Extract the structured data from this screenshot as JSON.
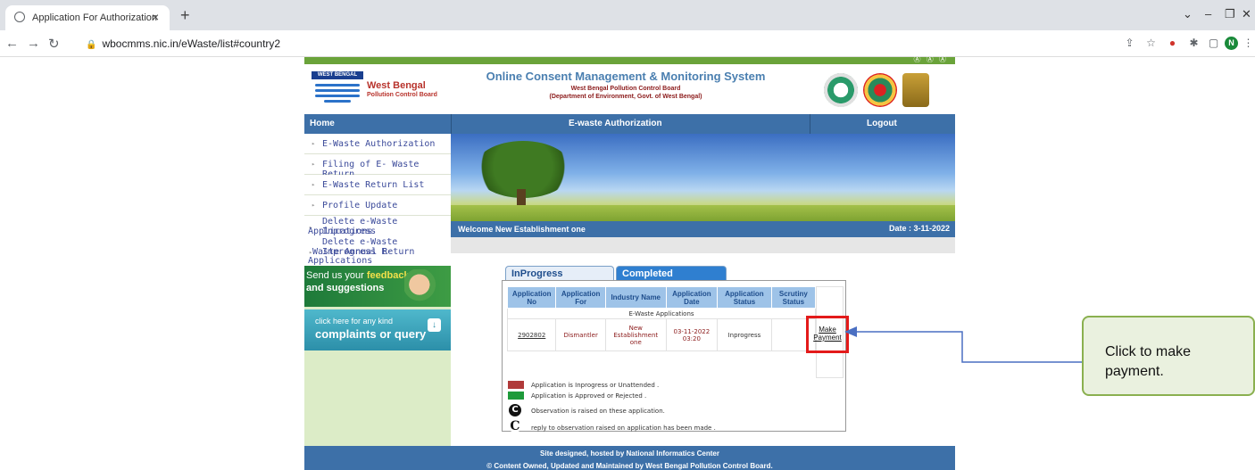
{
  "browser": {
    "tab_title": "Application For Authorization",
    "tab_close": "×",
    "new_tab": "+",
    "url": "wbocmms.nic.in/eWaste/list#country2",
    "profile_initial": "N"
  },
  "header": {
    "access_icons": "Ⓐ Ⓐ Ⓐ",
    "logo_banner": "WEST BENGAL",
    "logo_name": "West Bengal",
    "logo_sub": "Pollution Control Board",
    "title": "Online Consent Management & Monitoring System",
    "sub1": "West Bengal Pollution Control Board",
    "sub2": "(Department of Environment, Govt. of West Bengal)"
  },
  "menu": {
    "home": "Home",
    "ewaste": "E-waste Authorization",
    "logout": "Logout"
  },
  "sidebar": {
    "items": [
      {
        "label": "E-Waste Authorization"
      },
      {
        "label": "Filing of E- Waste Return"
      },
      {
        "label": "E-Waste Return List"
      },
      {
        "label": "Profile Update"
      }
    ],
    "delete_inprogress_l1": "Delete e-Waste Inprogress",
    "delete_inprogress_l2": "Applications",
    "delete_return_l1": "Delete e-Waste Inprogress E-",
    "delete_return_l2": "Waste Annual Return",
    "delete_return_l3": "Applications",
    "feedback_pre": "Send us your ",
    "feedback_bold": "feedback",
    "feedback_line2": "and suggestions",
    "complaint_l1": "click here for any kind",
    "complaint_l2": "complaints or query",
    "complaint_arrow": "↓"
  },
  "welcome": {
    "text": "Welcome New Establishment one",
    "date": "Date : 3-11-2022"
  },
  "tabs": {
    "inprogress": "InProgress Application",
    "completed": "Completed Application"
  },
  "table": {
    "headers": [
      "Application No",
      "Application For",
      "Industry Name",
      "Application Date",
      "Application Status",
      "Scrutiny Status"
    ],
    "group": "E-Waste Applications",
    "row": {
      "app_no": "2902802",
      "app_for": "Dismantler",
      "industry": "New Establishment one",
      "date": "03-11-2022 03:20",
      "status": "Inprogress",
      "scrutiny": "",
      "action": "Make Payment"
    }
  },
  "legend": {
    "red": "Application is Inprogress or Unattended .",
    "green": "Application is Approved or Rejected .",
    "obs": "Observation is raised on these application.",
    "reply": "reply to observation raised on application has been made .",
    "obs_glyph": "C",
    "reply_glyph": "C"
  },
  "footer": {
    "line1": "Site designed, hosted by National Informatics Center",
    "line2": "© Content Owned, Updated and Maintained by West Bengal Pollution Control Board."
  },
  "callout": {
    "text": "Click to make payment."
  },
  "colors": {
    "menu_blue": "#3d70a8",
    "highlight_red": "#e31a1a",
    "callout_green": "#8ab04f"
  }
}
